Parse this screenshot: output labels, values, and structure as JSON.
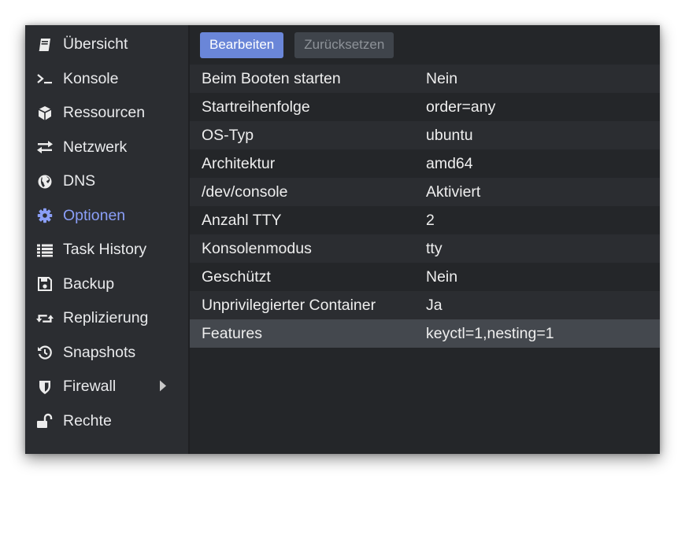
{
  "sidebar": {
    "items": [
      {
        "label": "Übersicht",
        "icon": "book-icon"
      },
      {
        "label": "Konsole",
        "icon": "terminal-icon"
      },
      {
        "label": "Ressourcen",
        "icon": "cube-icon"
      },
      {
        "label": "Netzwerk",
        "icon": "exchange-icon"
      },
      {
        "label": "DNS",
        "icon": "globe-icon"
      },
      {
        "label": "Optionen",
        "icon": "gear-icon",
        "active": true
      },
      {
        "label": "Task History",
        "icon": "list-icon"
      },
      {
        "label": "Backup",
        "icon": "floppy-disk-icon"
      },
      {
        "label": "Replizierung",
        "icon": "retweet-icon"
      },
      {
        "label": "Snapshots",
        "icon": "history-icon"
      },
      {
        "label": "Firewall",
        "icon": "shield-icon",
        "has_submenu": true
      },
      {
        "label": "Rechte",
        "icon": "unlock-icon"
      }
    ]
  },
  "toolbar": {
    "edit_label": "Bearbeiten",
    "reset_label": "Zurücksetzen"
  },
  "options": {
    "rows": [
      {
        "key": "Beim Booten starten",
        "value": "Nein"
      },
      {
        "key": "Startreihenfolge",
        "value": "order=any"
      },
      {
        "key": "OS-Typ",
        "value": "ubuntu"
      },
      {
        "key": "Architektur",
        "value": "amd64"
      },
      {
        "key": "/dev/console",
        "value": "Aktiviert"
      },
      {
        "key": "Anzahl TTY",
        "value": "2"
      },
      {
        "key": "Konsolenmodus",
        "value": "tty"
      },
      {
        "key": "Geschützt",
        "value": "Nein"
      },
      {
        "key": "Unprivilegierter Container",
        "value": "Ja"
      },
      {
        "key": "Features",
        "value": "keyctl=1,nesting=1",
        "selected": true
      }
    ]
  },
  "colors": {
    "accent": "#8a9ef7",
    "primary_button": "#6a86d8",
    "background": "#242629",
    "sidebar_bg": "#2b2d31"
  }
}
